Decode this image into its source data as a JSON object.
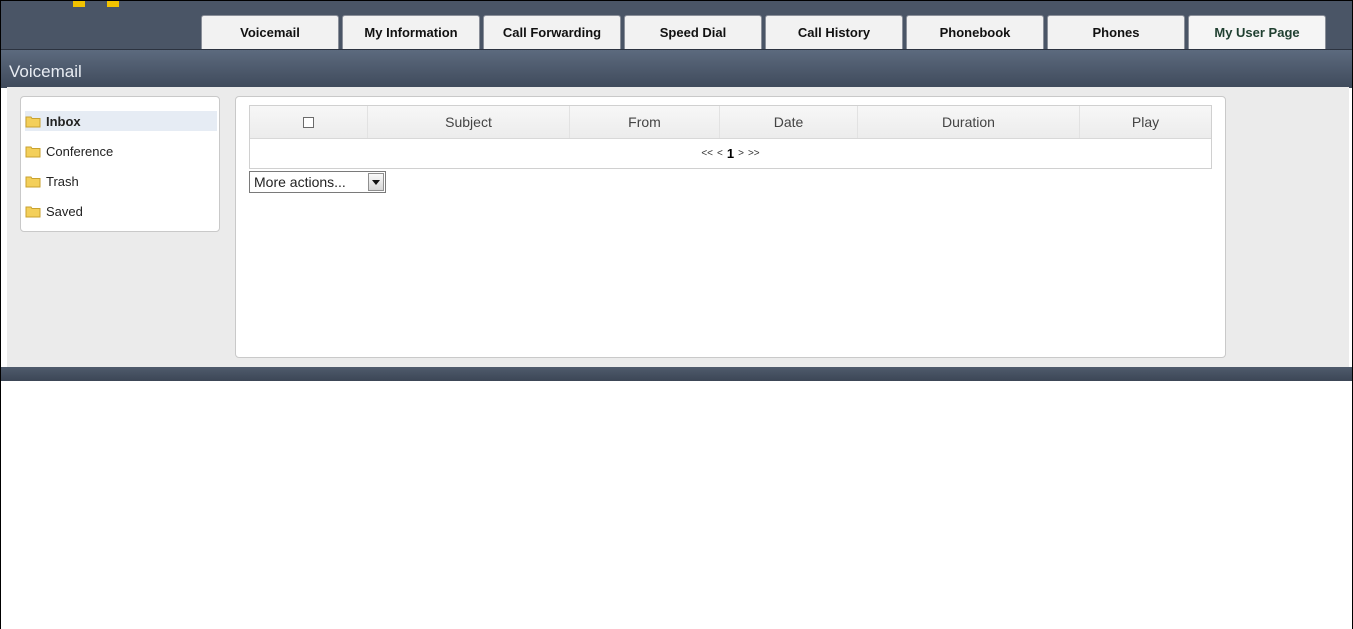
{
  "tabs": [
    {
      "label": "Voicemail"
    },
    {
      "label": "My Information"
    },
    {
      "label": "Call Forwarding"
    },
    {
      "label": "Speed Dial"
    },
    {
      "label": "Call History"
    },
    {
      "label": "Phonebook"
    },
    {
      "label": "Phones"
    },
    {
      "label": "My User Page"
    }
  ],
  "section": {
    "title": "Voicemail"
  },
  "folders": [
    {
      "label": "Inbox",
      "selected": true
    },
    {
      "label": "Conference",
      "selected": false
    },
    {
      "label": "Trash",
      "selected": false
    },
    {
      "label": "Saved",
      "selected": false
    }
  ],
  "table": {
    "columns": [
      "Subject",
      "From",
      "Date",
      "Duration",
      "Play"
    ],
    "rows": []
  },
  "pager": {
    "first": "<<",
    "prev": "<",
    "current": "1",
    "next": ">",
    "last": ">>"
  },
  "actions": {
    "selected": "More actions..."
  },
  "colors": {
    "header_band": "#4a5566",
    "section_bar": "#4d5a6d",
    "content_bg": "#ebebeb",
    "accent_logo": "#f2c300",
    "folder_icon": "#f3cf5a"
  },
  "icons": {
    "folder": "folder-icon",
    "dropdown": "dropdown-arrow-icon",
    "checkbox": "checkbox-icon"
  }
}
